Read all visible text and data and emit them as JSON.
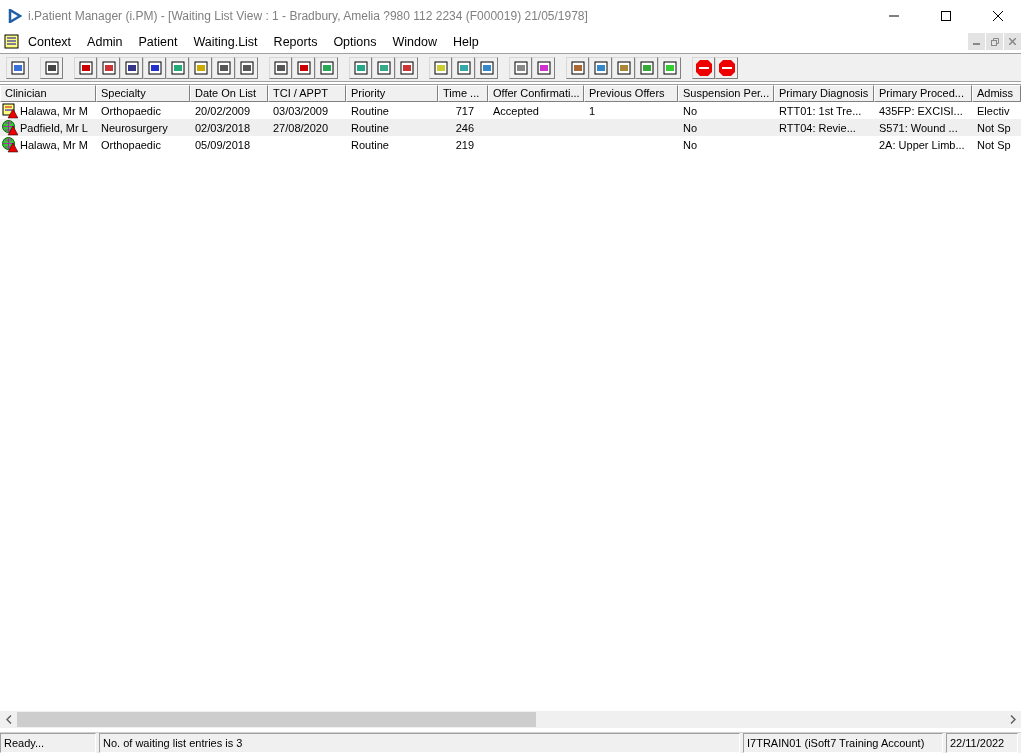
{
  "window": {
    "title": "i.Patient Manager (i.PM) - [Waiting List View :  1 - Bradbury, Amelia ?980 112 2234 (F000019) 21/05/1978]"
  },
  "menu": [
    "Context",
    "Admin",
    "Patient",
    "Waiting.List",
    "Reports",
    "Options",
    "Window",
    "Help"
  ],
  "table": {
    "columns": [
      "Clinician",
      "Specialty",
      "Date On List",
      "TCI / APPT",
      "Priority",
      "Time ...",
      "Offer Confirmati...",
      "Previous Offers",
      "Suspension Per...",
      "Primary Diagnosis",
      "Primary Proced...",
      "Admiss"
    ],
    "rows": [
      {
        "kind": "note",
        "selected": false,
        "cells": [
          "Halawa, Mr M",
          "Orthopaedic",
          "20/02/2009",
          "03/03/2009",
          "Routine",
          "717",
          "Accepted",
          "1",
          "No",
          "RTT01: 1st Tre...",
          "435FP: EXCISI...",
          "Electiv"
        ]
      },
      {
        "kind": "globe",
        "selected": true,
        "cells": [
          "Padfield, Mr L",
          "Neurosurgery",
          "02/03/2018",
          "27/08/2020",
          "Routine",
          "246",
          "",
          "",
          "No",
          "RTT04: Revie...",
          "S571: Wound ...",
          "Not Sp"
        ]
      },
      {
        "kind": "globe",
        "selected": false,
        "cells": [
          "Halawa, Mr M",
          "Orthopaedic",
          "05/09/2018",
          "",
          "Routine",
          "219",
          "",
          "",
          "No",
          "",
          "2A: Upper Limb...",
          "Not Sp"
        ]
      }
    ]
  },
  "status_bar": [
    "Ready...",
    "No. of waiting list entries is 3",
    "I7TRAIN01 (iSoft7 Training Account)",
    "22/11/2022"
  ]
}
